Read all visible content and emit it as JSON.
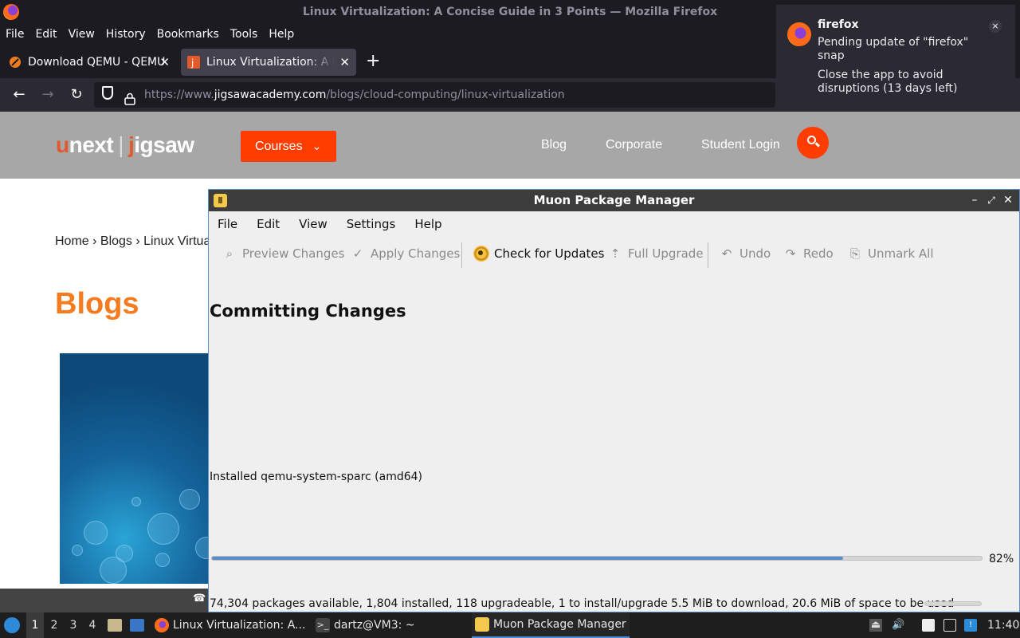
{
  "firefox": {
    "window_title": "Linux Virtualization: A Concise Guide in 3 Points — Mozilla Firefox",
    "menu": [
      "File",
      "Edit",
      "View",
      "History",
      "Bookmarks",
      "Tools",
      "Help"
    ],
    "tabs": [
      {
        "label": "Download QEMU - QEMU",
        "active": false
      },
      {
        "label": "Linux Virtualization: A Co",
        "active": true
      }
    ],
    "url": {
      "scheme": "https://www.",
      "host": "jigsawacademy.com",
      "path": "/blogs/cloud-computing/linux-virtualization"
    }
  },
  "notification": {
    "title": "firefox",
    "body": "Pending update of \"firefox\" snap",
    "detail": "Close the app to avoid disruptions (13 days left)",
    "close": "×"
  },
  "website": {
    "brand": {
      "u": "u",
      "next": "next",
      "sep": "|",
      "j": "j",
      "igsaw": "igsaw"
    },
    "courses_label": "Courses",
    "nav": [
      "Blog",
      "Corporate",
      "Student Login"
    ],
    "breadcrumb": "Home › Blogs › Linux Virtua",
    "heading": "Blogs"
  },
  "muon": {
    "title": "Muon Package Manager",
    "menu": [
      "File",
      "Edit",
      "View",
      "Settings",
      "Help"
    ],
    "toolbar": {
      "preview": "Preview Changes",
      "apply": "Apply Changes",
      "check": "Check for Updates",
      "upgrade": "Full Upgrade",
      "undo": "Undo",
      "redo": "Redo",
      "unmark": "Unmark All"
    },
    "heading": "Committing Changes",
    "status": "Installed qemu-system-sparc (amd64)",
    "progress_fraction": 0.82,
    "progress_label": "82%",
    "statusbar": "74,304 packages available, 1,804 installed, 118 upgradeable, 1 to install/upgrade  5.5 MiB to download, 20.6 MiB of space to be used"
  },
  "taskbar": {
    "workspaces": [
      "1",
      "2",
      "3",
      "4"
    ],
    "tasks": [
      {
        "label": "Linux Virtualization: A..."
      },
      {
        "label": "dartz@VM3: ~"
      },
      {
        "label": "Muon Package Manager"
      }
    ],
    "clock": "11:40"
  },
  "colors": {
    "accent_orange": "#ff3d00",
    "heading_orange": "#f47b20",
    "progress_blue": "#5b8ec9"
  }
}
